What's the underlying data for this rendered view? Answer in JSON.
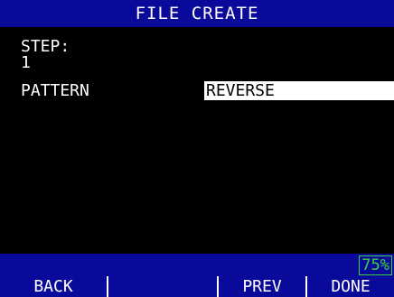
{
  "title": "FILE CREATE",
  "form": {
    "step_label": "STEP:",
    "step_value": "1",
    "pattern_label": "PATTERN",
    "pattern_value": "REVERSE"
  },
  "status": {
    "battery": "75%"
  },
  "softkeys": [
    "BACK",
    "",
    "PREV",
    "DONE"
  ],
  "colors": {
    "bar_blue": "#0a0a9a",
    "battery_green": "#3cd23c",
    "background": "#000000",
    "text": "#ffffff"
  }
}
